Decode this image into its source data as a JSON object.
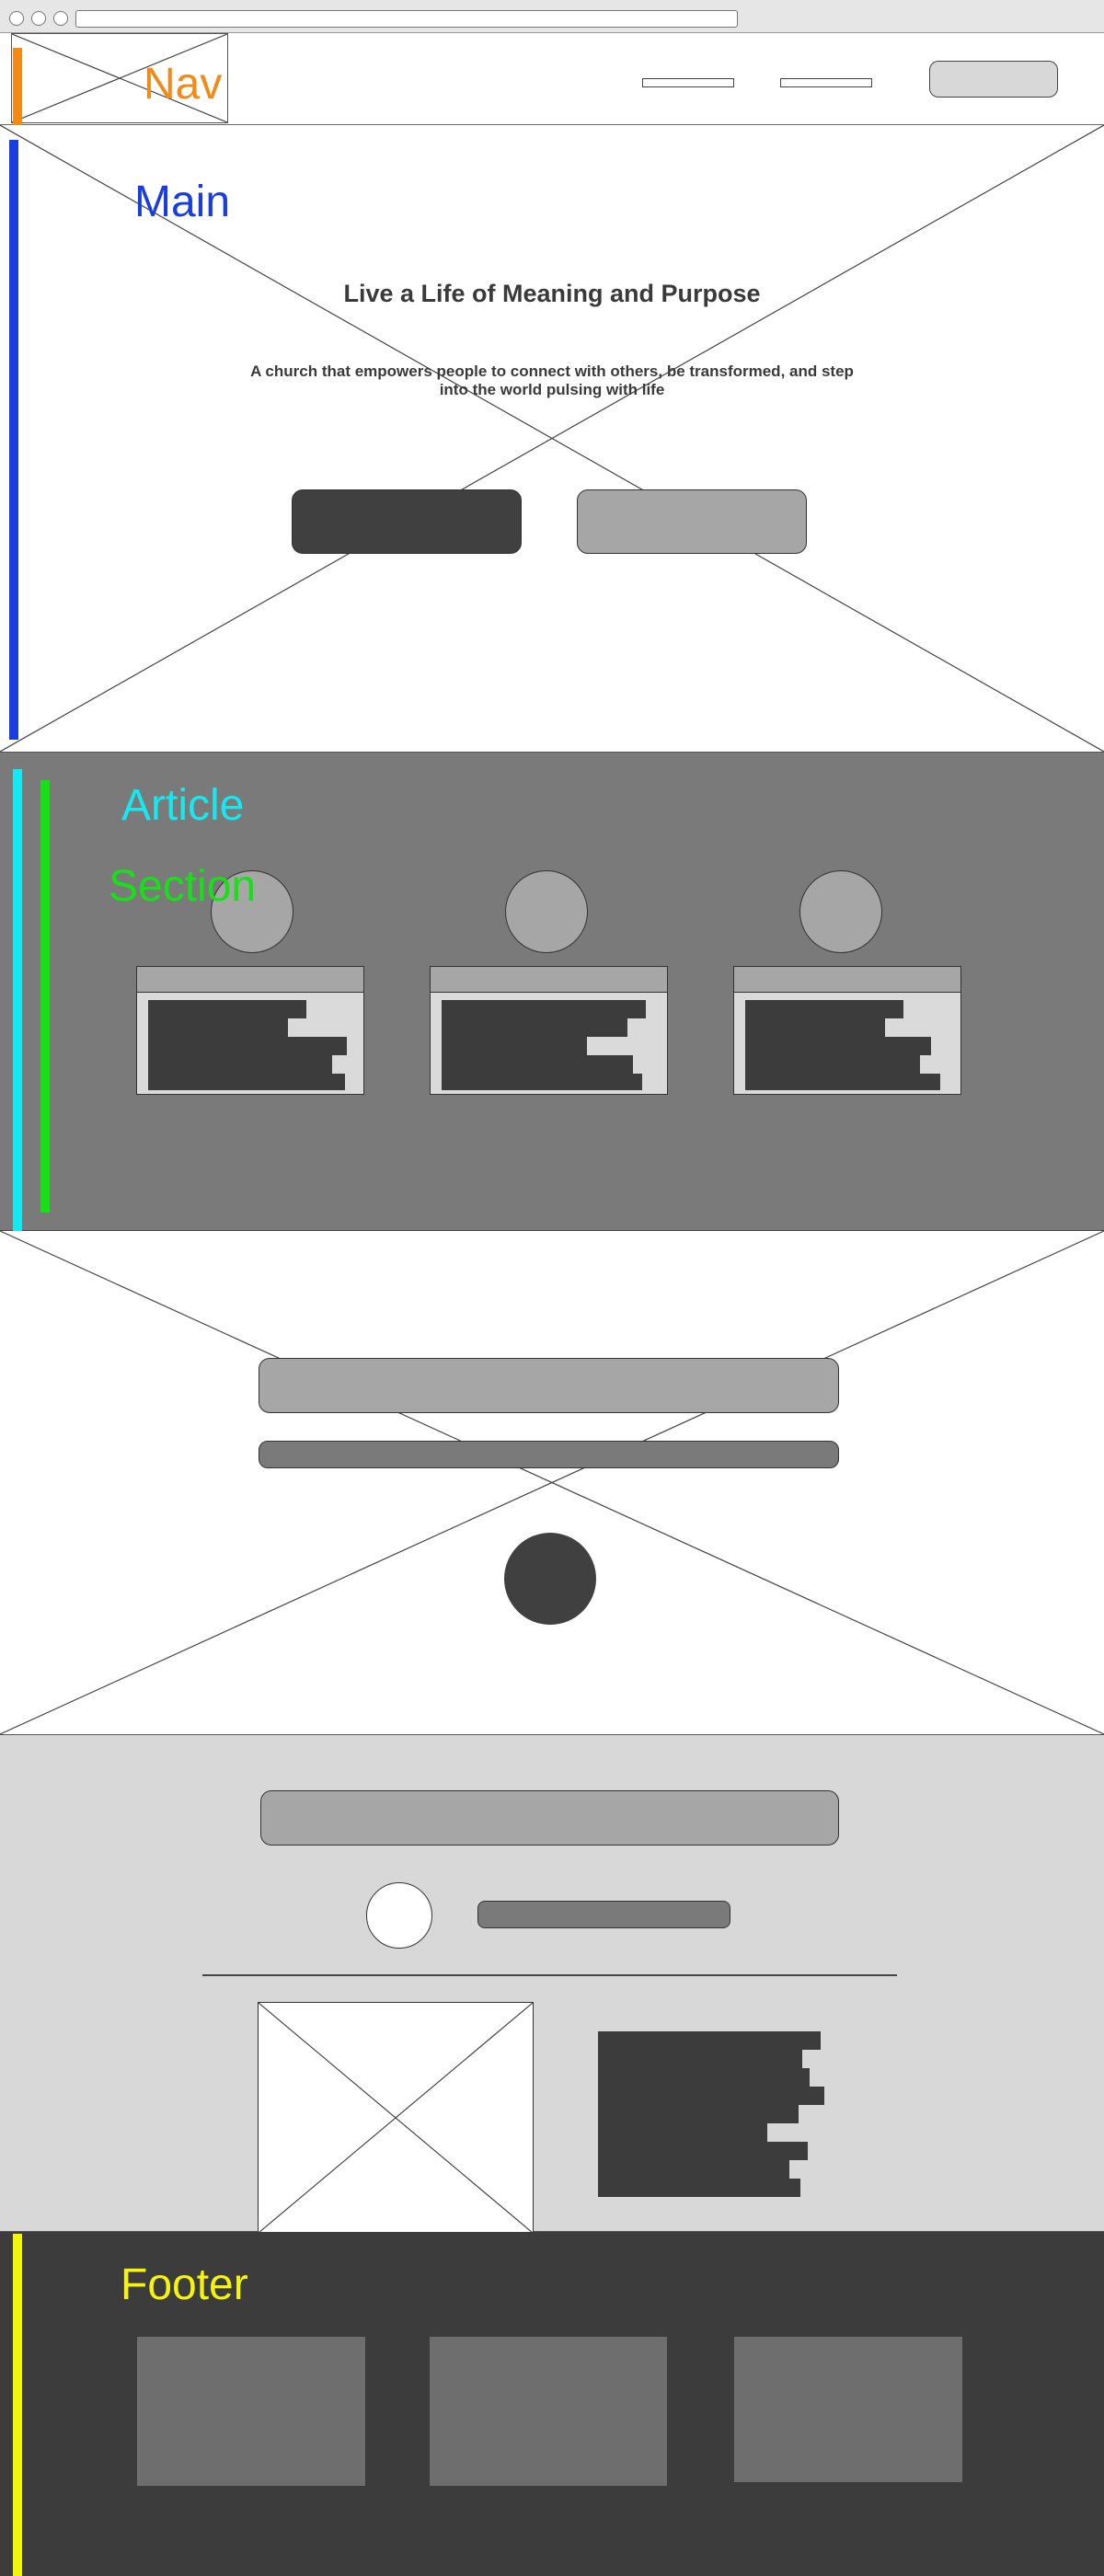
{
  "annotations": {
    "nav": {
      "label": "Nav",
      "color": "#f28a17"
    },
    "main": {
      "label": "Main",
      "color": "#1a3de0"
    },
    "article": {
      "label": "Article",
      "color": "#16e8f0"
    },
    "section": {
      "label": "Section",
      "color": "#18e018"
    },
    "footer": {
      "label": "Footer",
      "color": "#f5f50a"
    }
  },
  "hero": {
    "title": "Live a Life of Meaning and Purpose",
    "subtitle": "A church that empowers people to connect with others, be transformed, and step into the world pulsing with life"
  },
  "colors": {
    "dark_gray": "#404040",
    "mid_gray": "#7a7a7a",
    "light_gray": "#a6a6a6",
    "pale_gray": "#d8d8d8"
  }
}
